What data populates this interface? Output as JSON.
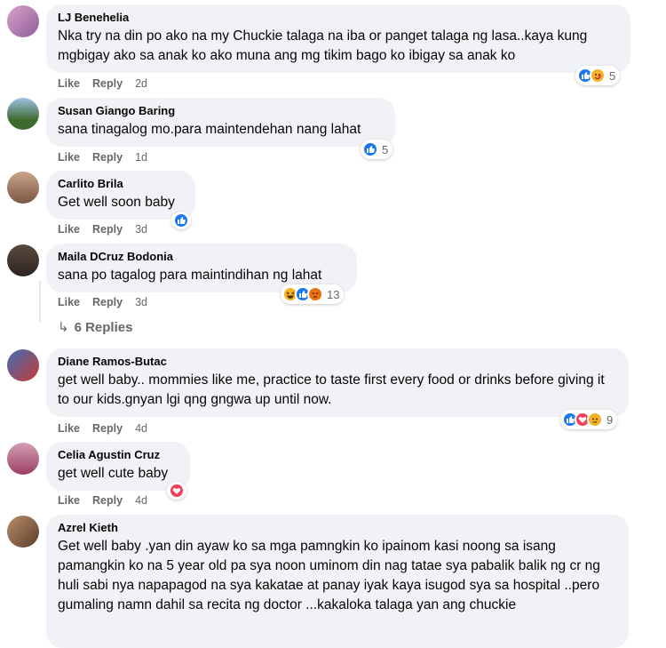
{
  "colors": {
    "like": "#1877f2",
    "love": "#f33e58",
    "haha": "#f7b125",
    "angry": "#e9710f",
    "bubble": "#f0f2f5",
    "meta": "#65676b"
  },
  "actions": {
    "like": "Like",
    "reply": "Reply"
  },
  "comments": [
    {
      "author": "LJ Benehelia",
      "text": "Nka try na din po ako na my Chuckie talaga na iba or panget talaga ng lasa..kaya kung mgbigay ako sa anak ko ako muna ang mg tikim bago ko ibigay sa anak ko",
      "time": "2d",
      "reactions": [
        "like-icon",
        "care-icon"
      ],
      "count": "5"
    },
    {
      "author": "Susan Giango Baring",
      "text": "sana tinagalog mo.para maintendehan nang lahat",
      "time": "1d",
      "reactions": [
        "like-icon"
      ],
      "count": "5"
    },
    {
      "author": "Carlito Brila",
      "text": "Get well soon baby",
      "time": "3d",
      "reactions": [
        "like-icon"
      ],
      "count": ""
    },
    {
      "author": "Maila DCruz Bodonia",
      "text": "sana po tagalog para maintindihan ng lahat",
      "time": "3d",
      "reactions": [
        "haha-icon",
        "like-icon",
        "angry-icon"
      ],
      "count": "13"
    },
    {
      "author": "Diane Ramos-Butac",
      "text": "get well baby.. mommies like me, practice to taste first every food or drinks before giving it to our kids.gnyan lgi qng gngwa up until now.",
      "time": "4d",
      "reactions": [
        "like-icon",
        "love-icon",
        "sad-icon"
      ],
      "count": "9"
    },
    {
      "author": "Celia Agustin Cruz",
      "text": "get well cute baby",
      "time": "4d",
      "reactions": [
        "love-icon"
      ],
      "count": ""
    },
    {
      "author": "Azrel Kieth",
      "text": "Get well baby .yan din ayaw ko sa mga pamngkin ko ipainom kasi noong sa isang pamangkin ko na 5 year old pa sya noon uminom din nag tatae sya pabalik balik ng cr ng huli sabi nya napapagod na sya kakatae at panay iyak kaya isugod sya sa hospital ..pero gumaling namn dahil sa recita ng doctor ...kakaloka talaga yan ang chuckie",
      "time": "",
      "reactions": [],
      "count": ""
    }
  ],
  "view_replies": "6 Replies"
}
